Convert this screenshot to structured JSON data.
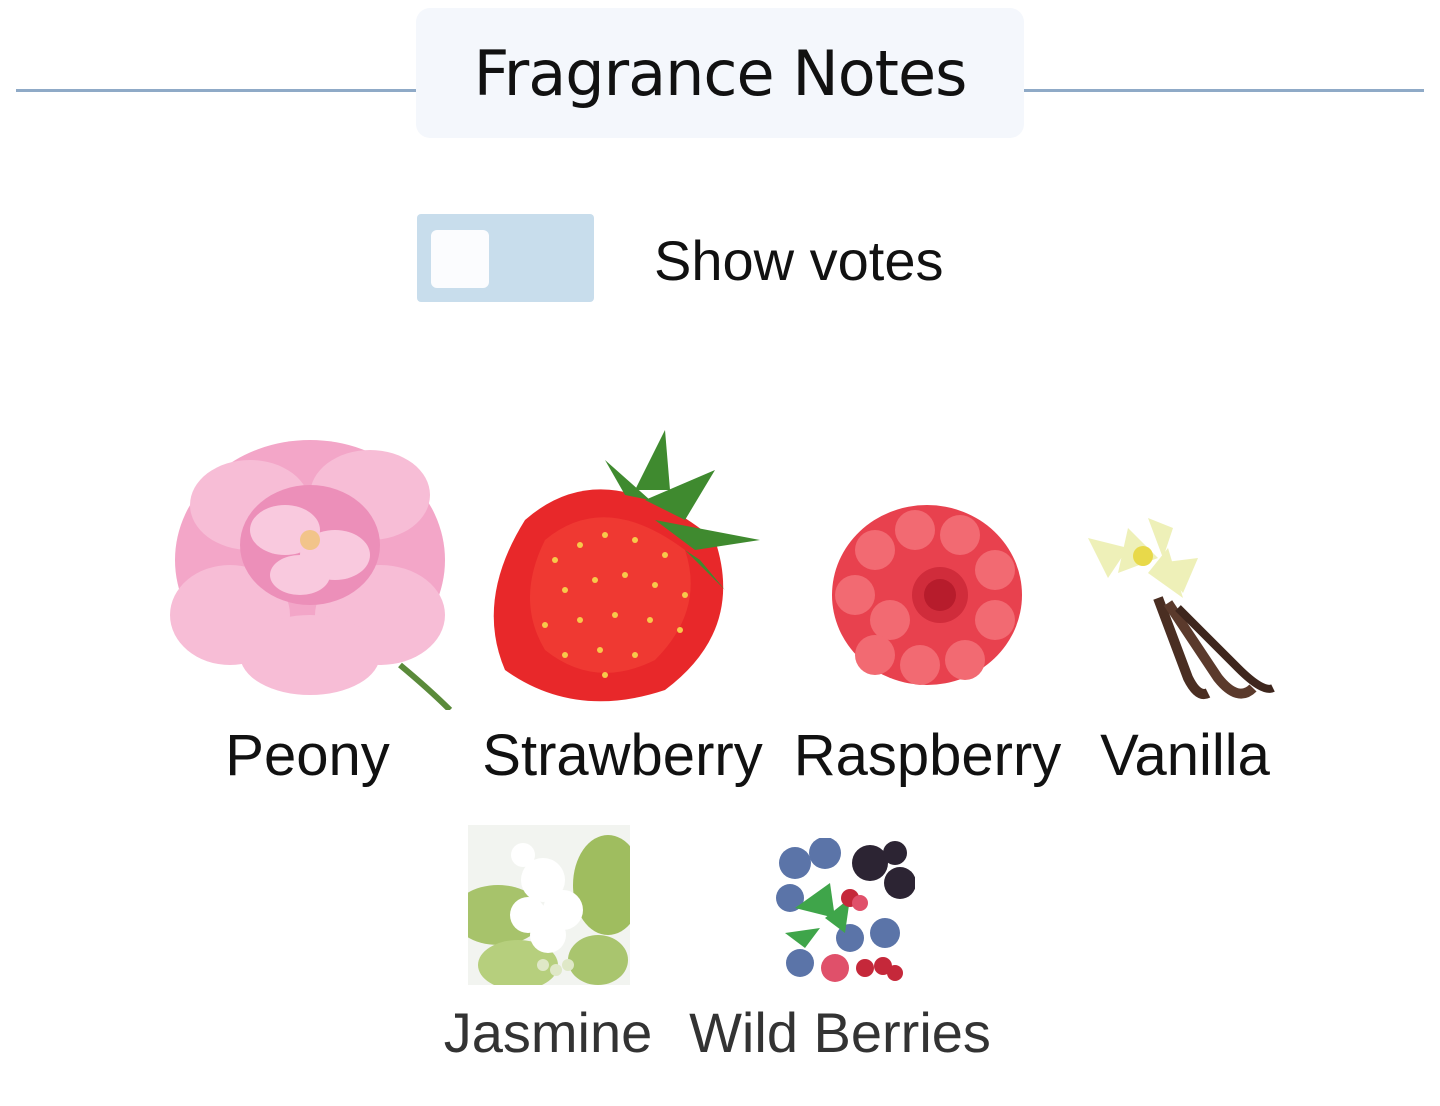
{
  "header": {
    "title": "Fragrance Notes"
  },
  "toggle": {
    "label": "Show votes",
    "checked": false,
    "track_color": "#c8ddec"
  },
  "notes": [
    {
      "name": "Peony",
      "icon": "peony-image"
    },
    {
      "name": "Strawberry",
      "icon": "strawberry-image"
    },
    {
      "name": "Raspberry",
      "icon": "raspberry-image"
    },
    {
      "name": "Vanilla",
      "icon": "vanilla-image"
    },
    {
      "name": "Jasmine",
      "icon": "jasmine-image"
    },
    {
      "name": "Wild Berries",
      "icon": "wild-berries-image"
    }
  ],
  "colors": {
    "divider": "#8faac7",
    "title_bg": "#f4f7fc"
  }
}
